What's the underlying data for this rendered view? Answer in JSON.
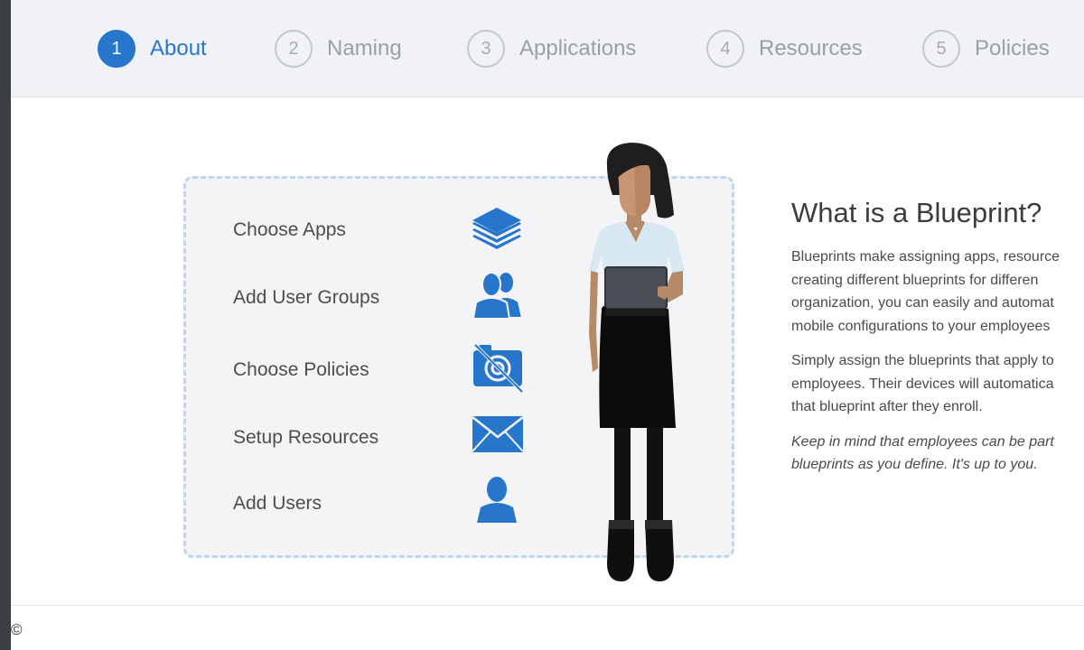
{
  "stepper": {
    "steps": [
      {
        "number": "1",
        "label": "About"
      },
      {
        "number": "2",
        "label": "Naming"
      },
      {
        "number": "3",
        "label": "Applications"
      },
      {
        "number": "4",
        "label": "Resources"
      },
      {
        "number": "5",
        "label": "Policies"
      }
    ],
    "active_step": 1,
    "accent_color": "#2776cc"
  },
  "overview": {
    "rows": [
      {
        "label": "Choose Apps",
        "icon": "layers-icon"
      },
      {
        "label": "Add User Groups",
        "icon": "user-group-icon"
      },
      {
        "label": "Choose Policies",
        "icon": "camera-disabled-icon"
      },
      {
        "label": "Setup Resources",
        "icon": "envelope-icon"
      },
      {
        "label": "Add Users",
        "icon": "user-icon"
      }
    ]
  },
  "info": {
    "title": "What is a Blueprint?",
    "paragraph1": [
      "Blueprints make assigning apps, resource",
      "creating different blueprints for differen",
      "organization, you can easily and automat",
      "mobile configurations to your employees"
    ],
    "paragraph2": [
      "Simply assign the blueprints that apply to",
      "employees. Their devices will automatica",
      "that blueprint after they enroll."
    ],
    "note": [
      "Keep in mind that employees can be part",
      "blueprints as you define. It's up to you."
    ]
  },
  "footer": {
    "copyright_symbol": "©"
  }
}
